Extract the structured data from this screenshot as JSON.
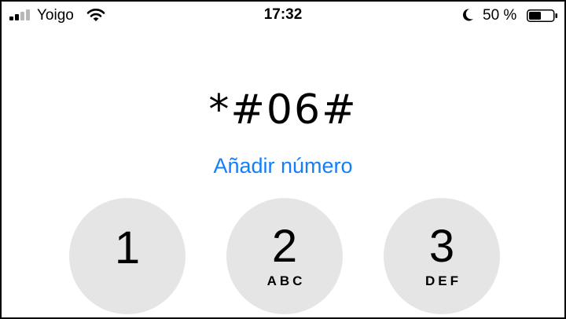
{
  "status_bar": {
    "carrier": "Yoigo",
    "time": "17:32",
    "battery_percent": "50 %",
    "signal_icon": "signal-bars-icon",
    "wifi_icon": "wifi-icon",
    "do_not_disturb_icon": "moon-icon",
    "battery_icon": "battery-icon"
  },
  "dialer": {
    "entry": "*#06#",
    "add_number_label": "Añadir número",
    "accent_color": "#147efb",
    "keys": [
      {
        "digit": "1",
        "letters": ""
      },
      {
        "digit": "2",
        "letters": "ABC"
      },
      {
        "digit": "3",
        "letters": "DEF"
      }
    ]
  }
}
